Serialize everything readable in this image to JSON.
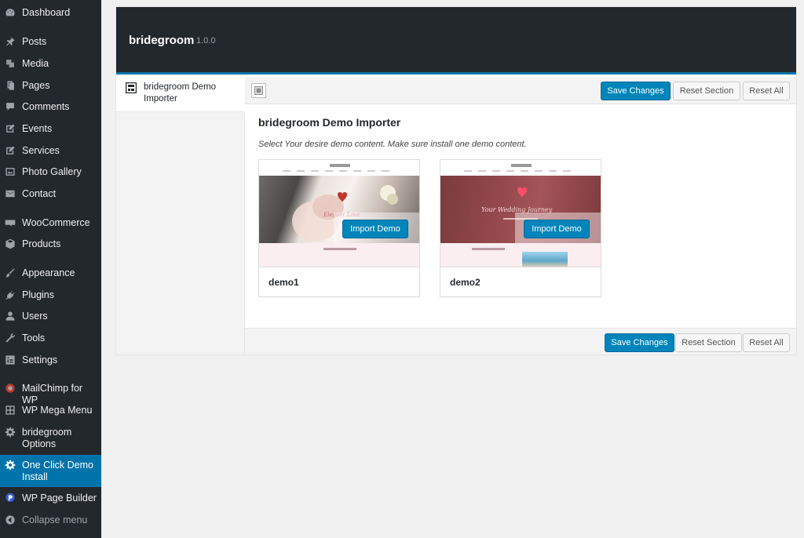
{
  "sidebar": {
    "items": [
      {
        "label": "Dashboard",
        "icon": "dashboard-icon"
      },
      {
        "label": "Posts",
        "icon": "pin-icon"
      },
      {
        "label": "Media",
        "icon": "media-icon"
      },
      {
        "label": "Pages",
        "icon": "pages-icon"
      },
      {
        "label": "Comments",
        "icon": "comments-icon"
      },
      {
        "label": "Events",
        "icon": "edit-icon"
      },
      {
        "label": "Services",
        "icon": "edit-icon"
      },
      {
        "label": "Photo Gallery",
        "icon": "gallery-icon"
      },
      {
        "label": "Contact",
        "icon": "mail-icon"
      },
      {
        "label": "WooCommerce",
        "icon": "woo-icon"
      },
      {
        "label": "Products",
        "icon": "box-icon"
      },
      {
        "label": "Appearance",
        "icon": "brush-icon"
      },
      {
        "label": "Plugins",
        "icon": "plugin-icon"
      },
      {
        "label": "Users",
        "icon": "user-icon"
      },
      {
        "label": "Tools",
        "icon": "wrench-icon"
      },
      {
        "label": "Settings",
        "icon": "settings-icon"
      },
      {
        "label": "MailChimp for WP",
        "icon": "mailchimp-icon"
      },
      {
        "label": "WP Mega Menu",
        "icon": "grid-icon"
      },
      {
        "label": "bridegroom Options",
        "icon": "gear-icon"
      },
      {
        "label": "One Click Demo Install",
        "icon": "gear-icon"
      },
      {
        "label": "WP Page Builder",
        "icon": "builder-icon"
      },
      {
        "label": "Collapse menu",
        "icon": "collapse-icon"
      }
    ],
    "current": "One Click Demo Install"
  },
  "panel": {
    "title": "bridegroom",
    "version": "1.0.0",
    "tab_label": "bridegroom Demo Importer"
  },
  "toolbar": {
    "save_label": "Save Changes",
    "reset_section_label": "Reset Section",
    "reset_all_label": "Reset All"
  },
  "section": {
    "title": "bridegroom Demo Importer",
    "description": "Select Your desire demo content. Make sure install one demo content."
  },
  "demos": [
    {
      "name": "demo1",
      "button": "Import Demo"
    },
    {
      "name": "demo2",
      "button": "Import Demo"
    }
  ],
  "colors": {
    "accent": "#0073aa",
    "button_primary": "#0085ba",
    "sidebar_bg": "#23282d"
  }
}
